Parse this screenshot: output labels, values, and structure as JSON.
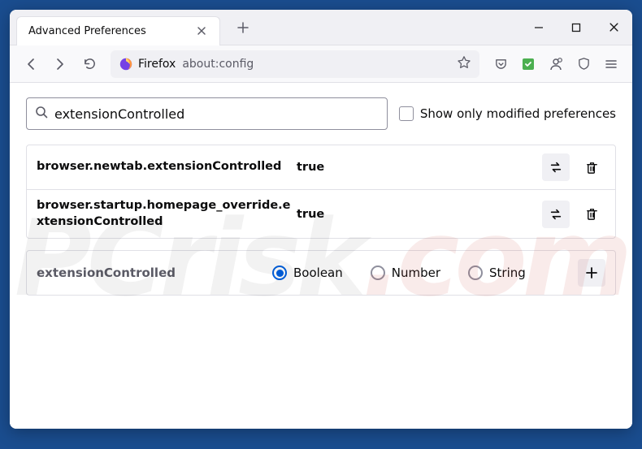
{
  "titlebar": {
    "tab_title": "Advanced Preferences"
  },
  "toolbar": {
    "brand_label": "Firefox",
    "url": "about:config"
  },
  "search": {
    "value": "extensionControlled",
    "checkbox_label": "Show only modified preferences"
  },
  "prefs": [
    {
      "name": "browser.newtab.extensionControlled",
      "value": "true"
    },
    {
      "name": "browser.startup.homepage_override.extensionControlled",
      "value": "true"
    }
  ],
  "add": {
    "name": "extensionControlled",
    "types": [
      {
        "label": "Boolean",
        "checked": true
      },
      {
        "label": "Number",
        "checked": false
      },
      {
        "label": "String",
        "checked": false
      }
    ]
  },
  "watermark": {
    "a": "PC",
    "b": "risk",
    "c": ".com"
  }
}
